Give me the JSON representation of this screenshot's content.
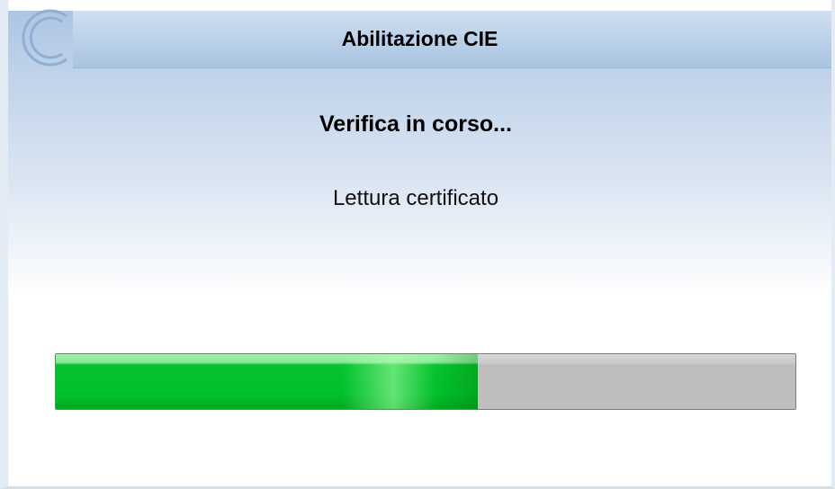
{
  "window": {
    "title": "Abilitazione CIE",
    "logo_icon": "cie-logo-icon"
  },
  "main": {
    "heading": "Verifica in corso...",
    "status": "Lettura certificato"
  },
  "progress": {
    "percent": 57,
    "fill_color": "#00c12a",
    "track_color": "#bfbfbf"
  },
  "colors": {
    "titlebar": "#a9c4e2",
    "background_top": "#a9c3e1"
  }
}
